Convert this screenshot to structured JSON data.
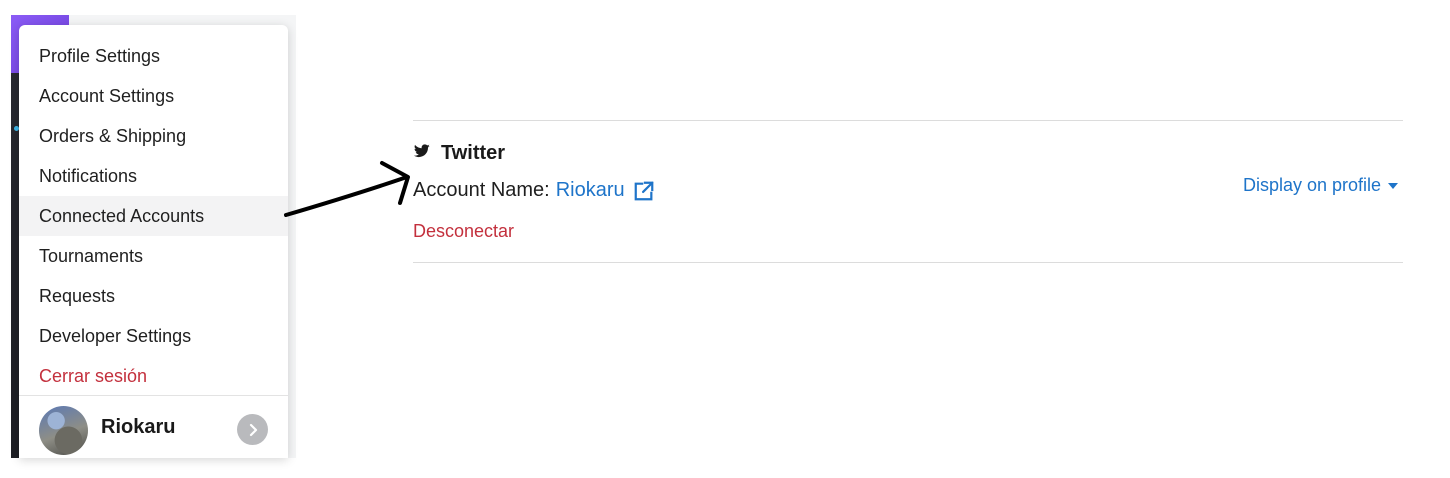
{
  "menu": {
    "items": [
      {
        "label": "Profile Settings"
      },
      {
        "label": "Account Settings"
      },
      {
        "label": "Orders & Shipping"
      },
      {
        "label": "Notifications"
      },
      {
        "label": "Connected Accounts",
        "active": true
      },
      {
        "label": "Tournaments"
      },
      {
        "label": "Requests"
      },
      {
        "label": "Developer Settings"
      },
      {
        "label": "Cerrar sesión",
        "danger": true
      }
    ],
    "footer": {
      "username": "Riokaru",
      "chevron_icon": "chevron-right-icon"
    }
  },
  "connected_account": {
    "service_icon": "twitter-bird-icon",
    "service": "Twitter",
    "account_name_label": "Account Name:",
    "account_name": "Riokaru",
    "external_link_icon": "external-link-icon",
    "disconnect_label": "Desconectar",
    "visibility_dropdown": "Display on profile",
    "dropdown_icon": "caret-down-icon"
  },
  "colors": {
    "link": "#1e74c9",
    "danger": "#c3303d",
    "active_row": "#f3f3f4",
    "divider": "#dcdcdc"
  }
}
